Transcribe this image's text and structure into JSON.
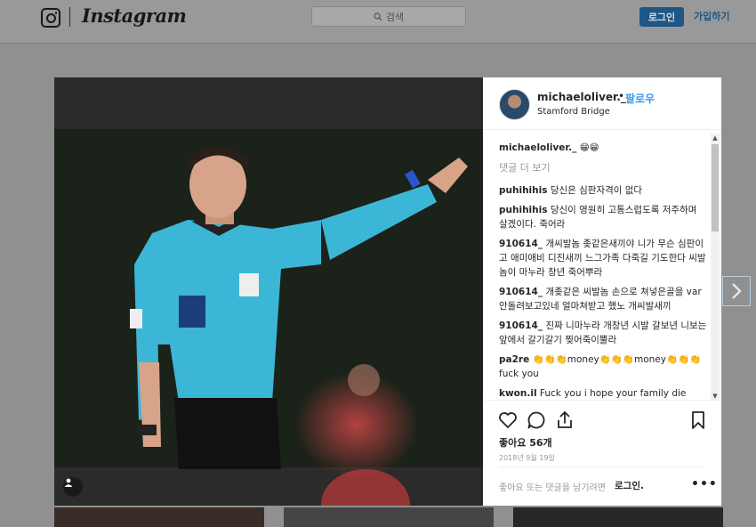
{
  "topbar": {
    "brand": "Instagram",
    "search_placeholder": "검색",
    "login_label": "로그인",
    "signup_label": "가입하기"
  },
  "post": {
    "username": "michaeloliver._",
    "separator": "•",
    "follow_label": "팔로우",
    "location": "Stamford Bridge",
    "caption_user": "michaeloliver._",
    "caption_text": "😁😁",
    "more_comments_label": "댓글 더 보기",
    "comments": [
      {
        "user": "puhihihis",
        "text": "당신은 심판자격이 없다"
      },
      {
        "user": "puhihihis",
        "text": "당신이 영원히 고통스럽도록 저주하며 살겠이다. 죽어라"
      },
      {
        "user": "910614_",
        "text": "개씨발놈 좆같은새끼야 니가 무슨 심판이고 애미애비 디진새끼 느그가족 다죽길 기도한다 씨발놈이 마누라 창년 죽어뿌라"
      },
      {
        "user": "910614_",
        "text": "개좆같은 씨발놈 손으로 쳐넣은골을 var 안돌려보고있네 얼마쳐받고 했노 개씨발새끼"
      },
      {
        "user": "910614_",
        "text": "진짜 니마누라 개창년 시발 갈보년 니보는앞에서 갈기갈기 찢어죽이뿔라"
      },
      {
        "user": "pa2re",
        "text": "👏👏👏money👏👏👏money👏👏👏 fuck you"
      },
      {
        "user": "kwon.il",
        "text": "Fuck you i hope your family die"
      }
    ],
    "likes": "좋아요 56개",
    "date": "2018년 9월 19일",
    "login_prompt": "좋아요 또는 댓글을 남기려면",
    "login_link": "로그인.",
    "more_options": "•••"
  },
  "icons": {
    "instagram": "instagram-glyph-icon",
    "search": "search-icon",
    "like": "heart-icon",
    "comment": "comment-icon",
    "share": "share-icon",
    "save": "bookmark-icon",
    "user_tags": "user-icon",
    "next": "chevron-right-icon"
  },
  "colors": {
    "link_blue": "#3897f0",
    "text": "#262626",
    "muted": "#999999"
  }
}
